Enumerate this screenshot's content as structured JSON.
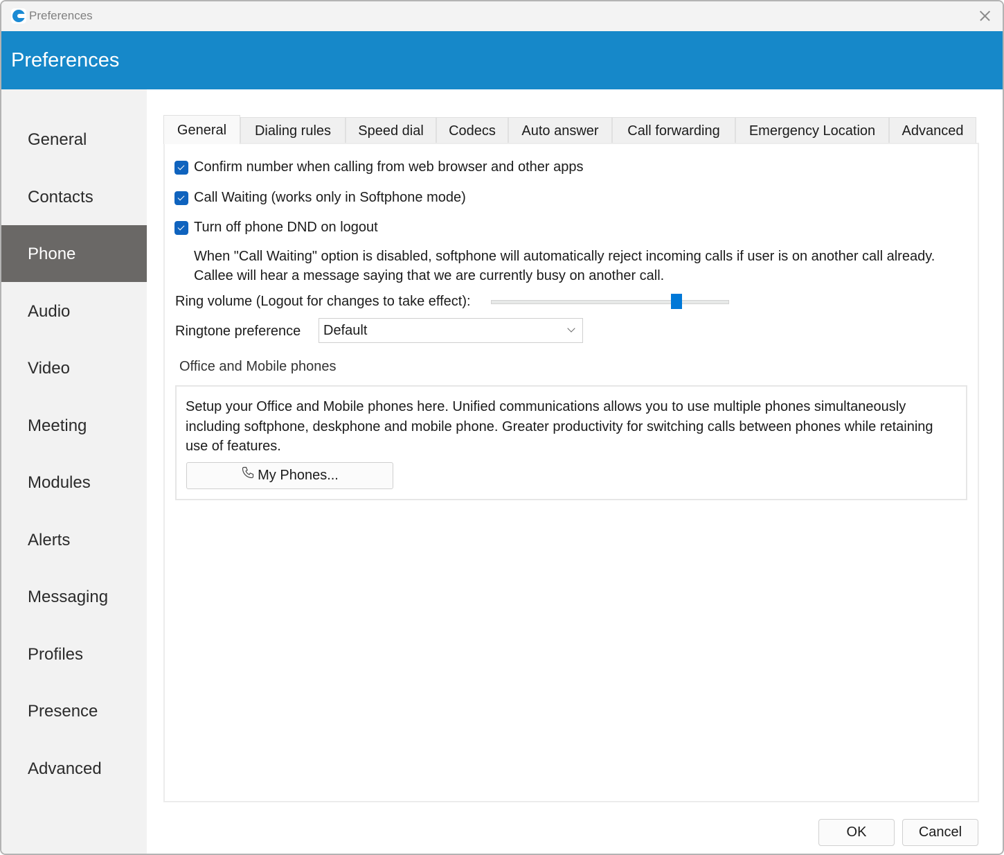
{
  "window": {
    "title": "Preferences",
    "app_icon": "app-logo-icon",
    "close_icon": "close-icon"
  },
  "header": {
    "title": "Preferences",
    "color": "#1688c9"
  },
  "sidebar": {
    "items": [
      {
        "label": "General",
        "active": false
      },
      {
        "label": "Contacts",
        "active": false
      },
      {
        "label": "Phone",
        "active": true
      },
      {
        "label": "Audio",
        "active": false
      },
      {
        "label": "Video",
        "active": false
      },
      {
        "label": "Meeting",
        "active": false
      },
      {
        "label": "Modules",
        "active": false
      },
      {
        "label": "Alerts",
        "active": false
      },
      {
        "label": "Messaging",
        "active": false
      },
      {
        "label": "Profiles",
        "active": false
      },
      {
        "label": "Presence",
        "active": false
      },
      {
        "label": "Advanced",
        "active": false
      }
    ]
  },
  "tabs": [
    {
      "label": "General",
      "active": true
    },
    {
      "label": "Dialing rules",
      "active": false
    },
    {
      "label": "Speed dial",
      "active": false
    },
    {
      "label": "Codecs",
      "active": false
    },
    {
      "label": "Auto answer",
      "active": false
    },
    {
      "label": "Call forwarding",
      "active": false
    },
    {
      "label": "Emergency Location",
      "active": false
    },
    {
      "label": "Advanced",
      "active": false
    }
  ],
  "general": {
    "checkboxes": [
      {
        "label": "Confirm number when calling from web browser and other apps",
        "checked": true
      },
      {
        "label": "Call Waiting (works only in Softphone mode)",
        "checked": true
      },
      {
        "label": "Turn off phone DND on logout",
        "checked": true
      }
    ],
    "call_waiting_info": "When \"Call Waiting\" option is disabled, softphone will automatically reject incoming calls if user is on another call already. Callee will hear a message saying that we are currently busy on another call.",
    "ring_volume": {
      "label": "Ring volume (Logout for changes to take effect):",
      "value_fraction": 0.78
    },
    "ringtone": {
      "label": "Ringtone preference",
      "selected": "Default"
    },
    "office_mobile": {
      "title": "Office and Mobile phones",
      "description": "Setup your Office and Mobile phones here. Unified communications allows you to use multiple phones simultaneously including softphone, deskphone and mobile phone. Greater productivity for switching calls between phones while retaining use of features.",
      "button_label": "My Phones...",
      "button_icon": "phone-icon"
    }
  },
  "footer": {
    "ok_label": "OK",
    "cancel_label": "Cancel"
  }
}
